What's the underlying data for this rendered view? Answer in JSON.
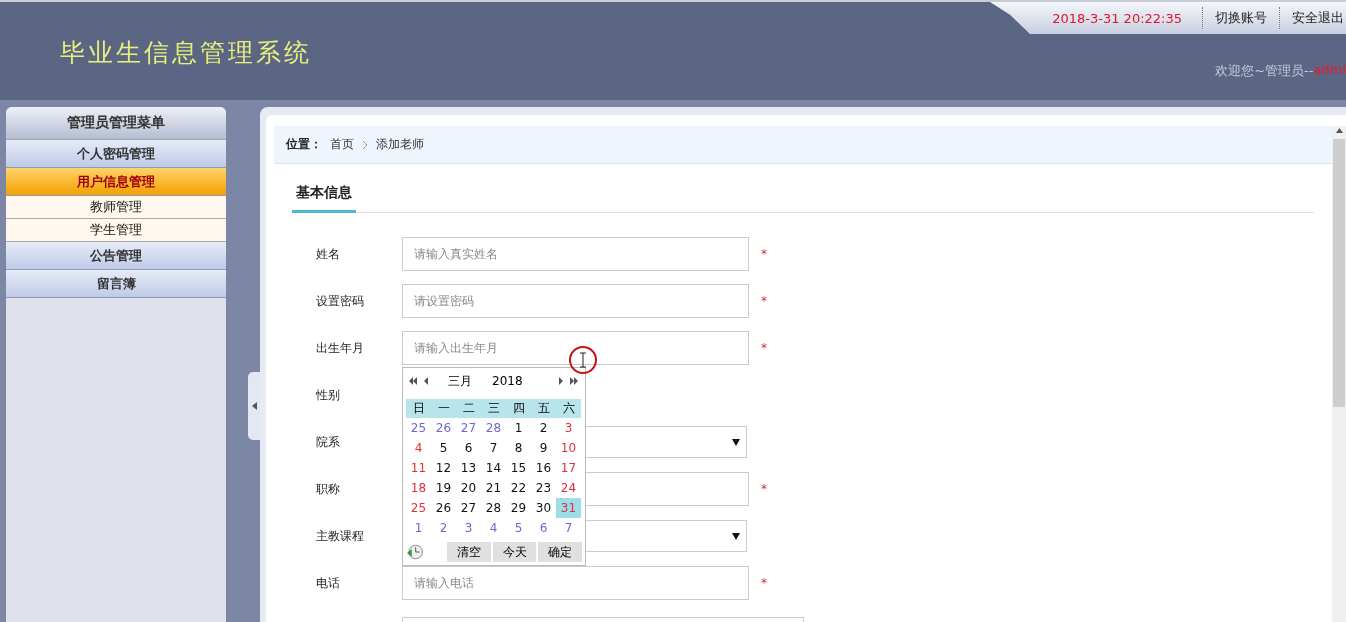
{
  "header": {
    "title": "毕业生信息管理系统",
    "datetime": "2018-3-31 20:22:35",
    "links": [
      "切换账号",
      "安全退出"
    ],
    "welcome": "欢迎您~管理员--",
    "user": "admi"
  },
  "sidebar": {
    "title": "管理员管理菜单",
    "items": [
      {
        "label": "个人密码管理",
        "selected": false
      },
      {
        "label": "用户信息管理",
        "selected": true,
        "children": [
          {
            "label": "教师管理"
          },
          {
            "label": "学生管理"
          }
        ]
      },
      {
        "label": "公告管理",
        "selected": false
      },
      {
        "label": "留言簿",
        "selected": false
      }
    ]
  },
  "breadcrumb": {
    "label": "位置：",
    "items": [
      "首页",
      "添加老师"
    ]
  },
  "section_tab": "基本信息",
  "form": [
    {
      "label": "姓名",
      "kind": "input",
      "placeholder": "请输入真实姓名",
      "mark": "*"
    },
    {
      "label": "设置密码",
      "kind": "input",
      "placeholder": "请设置密码",
      "mark": "*"
    },
    {
      "label": "出生年月",
      "kind": "input",
      "placeholder": "请输入出生年月",
      "mark": "*"
    },
    {
      "label": "性别",
      "kind": "none"
    },
    {
      "label": "院系",
      "kind": "select"
    },
    {
      "label": "职称",
      "kind": "input",
      "mark": "*"
    },
    {
      "label": "主教课程",
      "kind": "select"
    },
    {
      "label": "电话",
      "kind": "input",
      "placeholder": "请输入电话",
      "mark": "*"
    },
    {
      "kind": "textarea"
    }
  ],
  "calendar": {
    "month": "三月",
    "year": "2018",
    "weekdays": [
      "日",
      "一",
      "二",
      "三",
      "四",
      "五",
      "六"
    ],
    "days": [
      {
        "d": "25",
        "kind": "other",
        "selected": false
      },
      {
        "d": "26",
        "kind": "other",
        "selected": false
      },
      {
        "d": "27",
        "kind": "other",
        "selected": false
      },
      {
        "d": "28",
        "kind": "other",
        "selected": false
      },
      {
        "d": "1",
        "kind": "normal",
        "selected": false
      },
      {
        "d": "2",
        "kind": "normal",
        "selected": false
      },
      {
        "d": "3",
        "kind": "weekend",
        "selected": false
      },
      {
        "d": "4",
        "kind": "weekend",
        "selected": false
      },
      {
        "d": "5",
        "kind": "normal",
        "selected": false
      },
      {
        "d": "6",
        "kind": "normal",
        "selected": false
      },
      {
        "d": "7",
        "kind": "normal",
        "selected": false
      },
      {
        "d": "8",
        "kind": "normal",
        "selected": false
      },
      {
        "d": "9",
        "kind": "normal",
        "selected": false
      },
      {
        "d": "10",
        "kind": "weekend",
        "selected": false
      },
      {
        "d": "11",
        "kind": "weekend",
        "selected": false
      },
      {
        "d": "12",
        "kind": "normal",
        "selected": false
      },
      {
        "d": "13",
        "kind": "normal",
        "selected": false
      },
      {
        "d": "14",
        "kind": "normal",
        "selected": false
      },
      {
        "d": "15",
        "kind": "normal",
        "selected": false
      },
      {
        "d": "16",
        "kind": "normal",
        "selected": false
      },
      {
        "d": "17",
        "kind": "weekend",
        "selected": false
      },
      {
        "d": "18",
        "kind": "weekend",
        "selected": false
      },
      {
        "d": "19",
        "kind": "normal",
        "selected": false
      },
      {
        "d": "20",
        "kind": "normal",
        "selected": false
      },
      {
        "d": "21",
        "kind": "normal",
        "selected": false
      },
      {
        "d": "22",
        "kind": "normal",
        "selected": false
      },
      {
        "d": "23",
        "kind": "normal",
        "selected": false
      },
      {
        "d": "24",
        "kind": "weekend",
        "selected": false
      },
      {
        "d": "25",
        "kind": "weekend",
        "selected": false
      },
      {
        "d": "26",
        "kind": "normal",
        "selected": false
      },
      {
        "d": "27",
        "kind": "normal",
        "selected": false
      },
      {
        "d": "28",
        "kind": "normal",
        "selected": false
      },
      {
        "d": "29",
        "kind": "normal",
        "selected": false
      },
      {
        "d": "30",
        "kind": "normal",
        "selected": false
      },
      {
        "d": "31",
        "kind": "weekend",
        "selected": true
      },
      {
        "d": "1",
        "kind": "other",
        "selected": false
      },
      {
        "d": "2",
        "kind": "other",
        "selected": false
      },
      {
        "d": "3",
        "kind": "other",
        "selected": false
      },
      {
        "d": "4",
        "kind": "other",
        "selected": false
      },
      {
        "d": "5",
        "kind": "other",
        "selected": false
      },
      {
        "d": "6",
        "kind": "other",
        "selected": false
      },
      {
        "d": "7",
        "kind": "other",
        "selected": false
      }
    ],
    "buttons": [
      "清空",
      "今天",
      "确定"
    ]
  }
}
